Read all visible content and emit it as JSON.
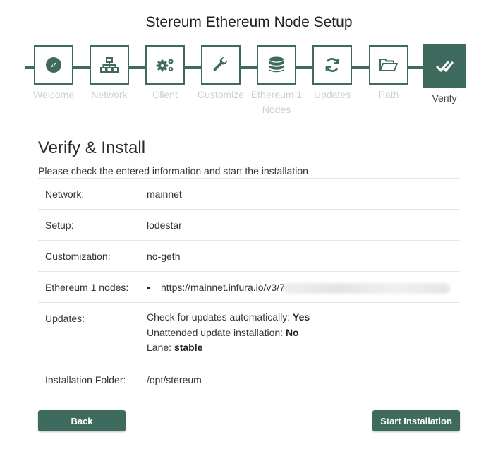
{
  "app": {
    "title": "Stereum Ethereum Node Setup"
  },
  "steps": [
    {
      "label": "Welcome",
      "icon": "compass-icon",
      "active": false
    },
    {
      "label": "Network",
      "icon": "network-icon",
      "active": false
    },
    {
      "label": "Client",
      "icon": "gears-icon",
      "active": false
    },
    {
      "label": "Customize",
      "icon": "wrench-icon",
      "active": false
    },
    {
      "label": "Ethereum 1 Nodes",
      "icon": "database-icon",
      "active": false
    },
    {
      "label": "Updates",
      "icon": "sync-icon",
      "active": false
    },
    {
      "label": "Path",
      "icon": "folder-open-icon",
      "active": false
    },
    {
      "label": "Verify",
      "icon": "double-check-icon",
      "active": true
    }
  ],
  "main": {
    "heading": "Verify & Install",
    "subtitle": "Please check the entered information and start the installation"
  },
  "details": {
    "network": {
      "label": "Network:",
      "value": "mainnet"
    },
    "setup": {
      "label": "Setup:",
      "value": "lodestar"
    },
    "customization": {
      "label": "Customization:",
      "value": "no-geth"
    },
    "nodes": {
      "label": "Ethereum 1 nodes:",
      "items": [
        "https://mainnet.infura.io/v3/7"
      ]
    },
    "updates": {
      "label": "Updates:",
      "auto_label": "Check for updates automatically:",
      "auto_value": "Yes",
      "unattended_label": "Unattended update installation:",
      "unattended_value": "No",
      "lane_label": "Lane:",
      "lane_value": "stable"
    },
    "folder": {
      "label": "Installation Folder:",
      "value": "/opt/stereum"
    }
  },
  "buttons": {
    "back": "Back",
    "start": "Start Installation"
  },
  "colors": {
    "accent": "#3e6b5d",
    "inactive_label": "#c9cfd2"
  }
}
